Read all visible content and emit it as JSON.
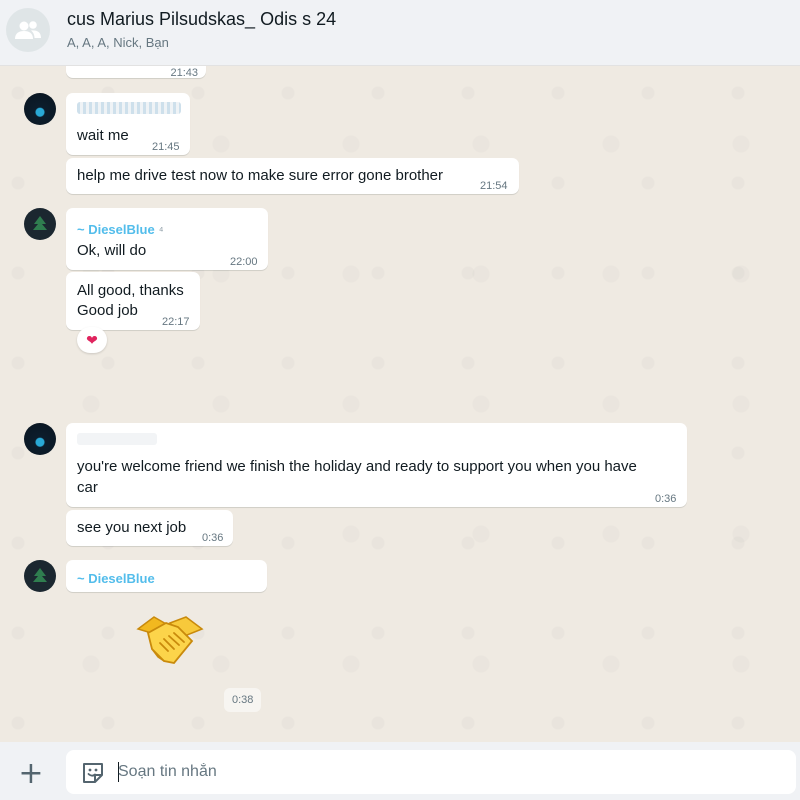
{
  "header": {
    "title": "cus Marius Pilsudskas_ Odis s 24",
    "members": "A, A, A, Nick, Bạn",
    "avatar_icon": "group-icon"
  },
  "messages": [
    {
      "text": "",
      "time": "21:43"
    },
    {
      "text": "wait me",
      "time": "21:45"
    },
    {
      "text": "help me drive test now to make sure error gone brother",
      "time": "21:54"
    },
    {
      "sender": "~ DieselBlue",
      "text": "Ok, will do",
      "time": "22:00"
    },
    {
      "text_line1": "All good, thanks",
      "text_line2": "Good job",
      "time": "22:17",
      "reaction": "❤"
    },
    {
      "text_line1": "you're welcome friend we finish the holiday and ready to support you when you have",
      "text_line2": "car",
      "time": "0:36"
    },
    {
      "text": "see you next job",
      "time": "0:36"
    },
    {
      "sender": "~ DieselBlue",
      "sticker": "handshake-sticker",
      "time": "0:38"
    }
  ],
  "composer": {
    "placeholder": "Soạn tin nhắn",
    "attach_icon": "plus-icon",
    "emoji_icon": "sticker-icon"
  },
  "colors": {
    "chat_background": "#efeae2",
    "bubble": "#ffffff",
    "sender_name": "#53bdeb",
    "header_background": "#f0f2f5"
  }
}
